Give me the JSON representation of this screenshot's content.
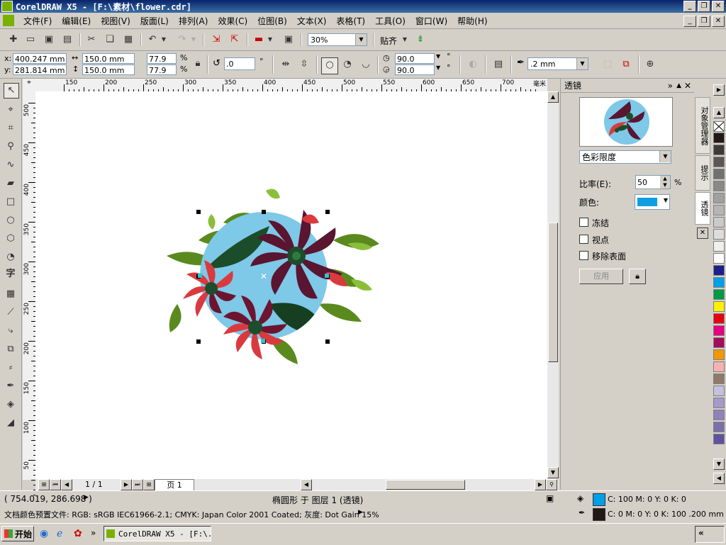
{
  "window": {
    "title": "CorelDRAW X5 - [F:\\素材\\flower.cdr]",
    "min_label": "_",
    "restore_label": "❐",
    "close_label": "✕"
  },
  "menu": {
    "items": [
      "文件(F)",
      "编辑(E)",
      "视图(V)",
      "版面(L)",
      "排列(A)",
      "效果(C)",
      "位图(B)",
      "文本(X)",
      "表格(T)",
      "工具(O)",
      "窗口(W)",
      "帮助(H)"
    ]
  },
  "toolbar": {
    "zoom_value": "30%",
    "snap_label": "贴齐"
  },
  "propbar": {
    "x_label": "x:",
    "x_value": "400.247 mm",
    "y_label": "y:",
    "y_value": "281.814 mm",
    "width_value": "150.0 mm",
    "height_value": "150.0 mm",
    "scale_w": "77.9",
    "scale_h": "77.9",
    "percent": "%",
    "rotation": ".0",
    "degree": "°",
    "start_angle": "90.0",
    "end_angle": "90.0",
    "outline_width": ".2 mm"
  },
  "ruler": {
    "units_label": "毫米",
    "h_labels": [
      "150",
      "200",
      "250",
      "300",
      "350",
      "400",
      "450",
      "500",
      "550",
      "600",
      "650",
      "700"
    ],
    "v_labels": [
      "500",
      "450",
      "400",
      "350",
      "300",
      "250",
      "200",
      "150",
      "100",
      "50"
    ]
  },
  "pages": {
    "counter": "1 / 1",
    "tab": "页 1"
  },
  "docker": {
    "title": "透镜",
    "lens_type": "色彩限度",
    "rate_label": "比率(E):",
    "rate_value": "50",
    "rate_unit": "%",
    "color_label": "颜色:",
    "lens_color": "#0f9ee0",
    "freeze_label": "冻结",
    "viewpoint_label": "视点",
    "remove_face_label": "移除表面",
    "apply_label": "应用",
    "lock_icon": "lock-icon"
  },
  "side_tabs": {
    "object_manager": "对象管理器",
    "hints": "提示",
    "lens": "透镜"
  },
  "palette": {
    "colors": [
      "#ffffff",
      "#231815",
      "#3e3a39",
      "#595757",
      "#727171",
      "#898989",
      "#9fa0a0",
      "#b5b5b6",
      "#c9caca",
      "#dcdddd",
      "#efefef",
      "#ffffff",
      "#1d2088",
      "#00a0e9",
      "#009944",
      "#fff100",
      "#e60012",
      "#e4007f",
      "#a40b5d",
      "#f39800",
      "#f5b2b2",
      "#8f7a6b",
      "#c4c0df",
      "#a59aca",
      "#8f82bc",
      "#7a71a9",
      "#5f52a0"
    ]
  },
  "status": {
    "coords": "( 754.019, 286.698 )",
    "object_info": "椭圆形 于 图层 1 (透镜)",
    "profile": "文档颜色预置文件: RGB: sRGB IEC61966-2.1; CMYK: Japan Color 2001 Coated; 灰度: Dot Gain 15%",
    "fill_cmyk": "C: 100 M: 0 Y: 0 K: 0",
    "fill_color": "#00a0e9",
    "outline_cmyk": "C: 0 M: 0 Y: 0 K: 100  .200 mm",
    "outline_color": "#231815"
  },
  "taskbar": {
    "start": "开始",
    "task": "CorelDRAW X5 - [F:\\...",
    "tray_label": "«"
  }
}
